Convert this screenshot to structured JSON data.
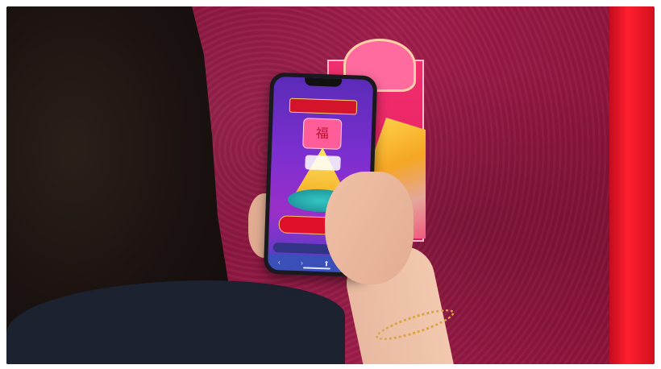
{
  "photo": {
    "description_colors": {
      "wall": "#8e1640",
      "column": "#ff1f2e",
      "poster": "#e31a5c",
      "hair": "#1a1210",
      "shirt": "#1d2230",
      "phone": "#1a1a1e"
    }
  },
  "phone_screen": {
    "banner_text": "",
    "lantern_glyph": "福"
  },
  "icons": {
    "share": "⬆",
    "tabs": "▢",
    "back": "‹",
    "forward": "›"
  }
}
